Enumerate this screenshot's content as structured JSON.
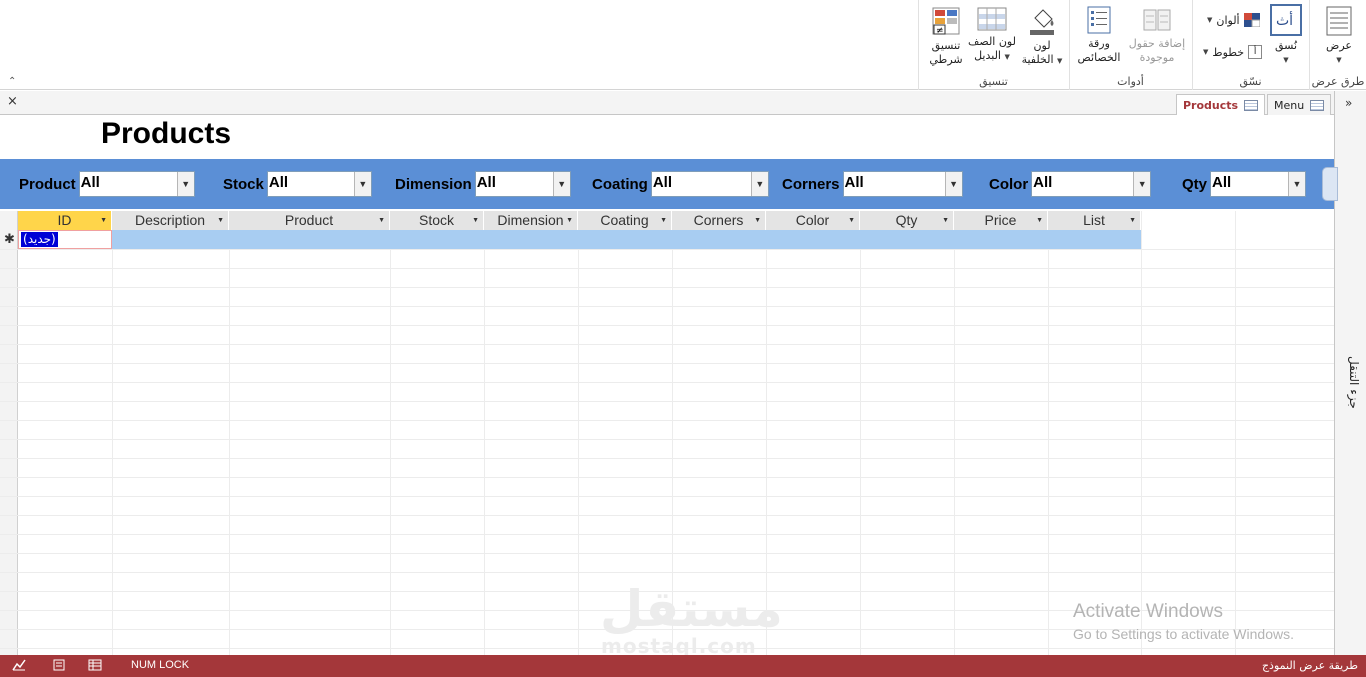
{
  "ribbon": {
    "groups": {
      "views": {
        "label": "طرق عرض",
        "view_button": "عرض"
      },
      "themes": {
        "label": "نسّق",
        "themes_button": "نُسق",
        "colors_button": "ألوان",
        "fonts_button": "خطوط"
      },
      "tools": {
        "label": "أدوات",
        "add_fields": "إضافة حقول موجودة",
        "property_sheet": "ورقة الخصائص"
      },
      "formatting": {
        "label": "تنسيق",
        "background_color": "لون الخلفية",
        "alt_row_color": "لون الصف البديل",
        "conditional_formatting": "تنسيق شرطي"
      }
    }
  },
  "tabs": [
    {
      "label": "Products",
      "active": true
    },
    {
      "label": "Menu",
      "active": false
    }
  ],
  "nav_pane": {
    "label": "جزء التنقل",
    "expand_glyph": "»"
  },
  "form": {
    "title": "Products",
    "close_glyph": "×",
    "filters": [
      {
        "label": "Product",
        "value": "All"
      },
      {
        "label": "Stock",
        "value": "All"
      },
      {
        "label": "Dimension",
        "value": "All"
      },
      {
        "label": "Coating",
        "value": "All"
      },
      {
        "label": "Corners",
        "value": "All"
      },
      {
        "label": "Color",
        "value": "All"
      },
      {
        "label": "Qty",
        "value": "All"
      }
    ],
    "grid": {
      "columns": [
        "ID",
        "Description",
        "Product",
        "Stock",
        "Dimension",
        "Coating",
        "Corners",
        "Color",
        "Qty",
        "Price",
        "List"
      ],
      "new_record_marker": "✱",
      "new_record_text": "(جديد)"
    }
  },
  "watermark": {
    "arabic": "مستقل",
    "latin": "mostaql.com"
  },
  "activation": {
    "line1": "Activate Windows",
    "line2": "Go to Settings to activate Windows."
  },
  "status": {
    "mode": "طريقة عرض النموذج",
    "numlock": "NUM LOCK"
  },
  "colors": {
    "accent": "#a4373a",
    "filter_bar": "#5b8fd6",
    "new_row": "#a8cdf2",
    "selected_header": "#ffd54a"
  }
}
